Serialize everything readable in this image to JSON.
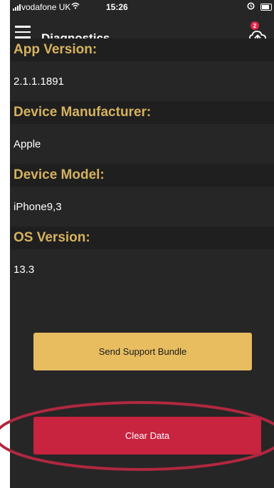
{
  "status_bar": {
    "carrier": "vodafone UK",
    "time": "15:26"
  },
  "header": {
    "title": "Diagnostics",
    "notification_count": "2"
  },
  "sections": [
    {
      "label": "App Version:",
      "value": "2.1.1.1891"
    },
    {
      "label": "Device Manufacturer:",
      "value": "Apple"
    },
    {
      "label": "Device Model:",
      "value": "iPhone9,3"
    },
    {
      "label": "OS Version:",
      "value": "13.3"
    }
  ],
  "actions": {
    "support_label": "Send Support Bundle",
    "clear_label": "Clear Data"
  },
  "colors": {
    "accent_gold": "#d6b25e",
    "button_gold": "#e7bd60",
    "button_red": "#c8233f",
    "background": "#262626",
    "annotation": "#b0283f"
  },
  "icons": {
    "menu": "hamburger-menu-icon",
    "upload": "cloud-upload-icon",
    "signal": "signal-bars-icon",
    "wifi": "wifi-icon",
    "alarm": "alarm-icon",
    "battery": "battery-icon"
  }
}
